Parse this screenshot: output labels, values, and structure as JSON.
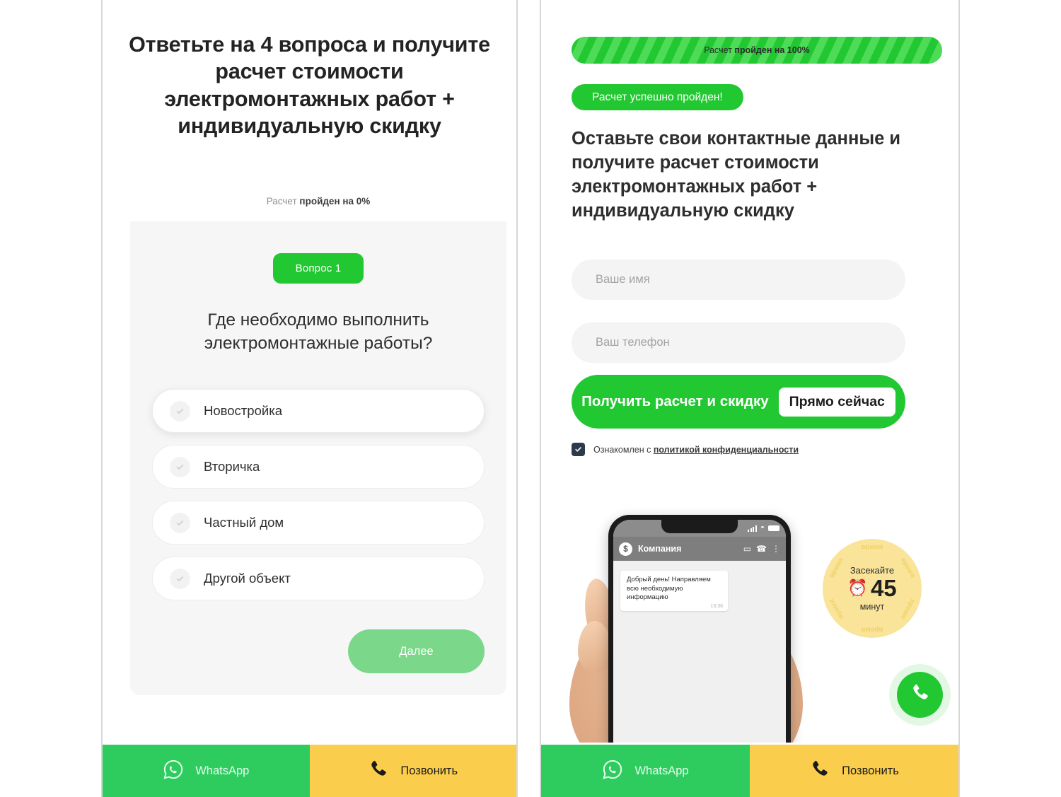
{
  "left_panel": {
    "headline": "Ответьте на 4 вопроса и получите расчет стоимости электромонтажных работ + индивидуальную скидку",
    "progress": {
      "prefix": "Расчет ",
      "bold": "пройден на 0%"
    },
    "question_badge": "Вопрос 1",
    "question": "Где необходимо выполнить электромонтажные работы?",
    "options": [
      {
        "label": "Новостройка"
      },
      {
        "label": "Вторичка"
      },
      {
        "label": "Частный дом"
      },
      {
        "label": "Другой объект"
      }
    ],
    "next_button": "Далее"
  },
  "right_panel": {
    "progress_bar": {
      "prefix": "Расчет ",
      "bold": "пройден на 100%"
    },
    "success_badge": "Расчет успешно пройден!",
    "subheadline": "Оставьте свои контактные данные и получите расчет стоимости электромонтажных работ + индивидуальную скидку",
    "form": {
      "name_placeholder": "Ваше имя",
      "name_value": "",
      "phone_placeholder": "Ваш телефон",
      "phone_value": "",
      "submit_main": "Получить расчет и скидку",
      "submit_chip": "Прямо сейчас"
    },
    "consent": {
      "text": "Ознакомлен с ",
      "link": "политикой конфиденциальности"
    },
    "phone_mock": {
      "app_title": "Компания",
      "avatar_glyph": "$",
      "message": "Добрый день! Направляем всю необходимую информацию",
      "time": "13:36"
    },
    "timer_badge": {
      "top": "Засекайте",
      "number": "45",
      "bottom": "минут",
      "ring_word": "время"
    }
  },
  "bottom_bar": {
    "whatsapp_label": "WhatsApp",
    "call_label": "Позвонить"
  },
  "colors": {
    "green": "#22c831",
    "green_light": "#4ddb58",
    "green_muted": "#7bd789",
    "whatsapp_green": "#2ecc5f",
    "yellow": "#fbcd4c",
    "badge_yellow": "#f9e49a",
    "dark": "#2c3a4b",
    "field_gray": "#f4f4f4",
    "card_gray": "#f6f6f6"
  }
}
